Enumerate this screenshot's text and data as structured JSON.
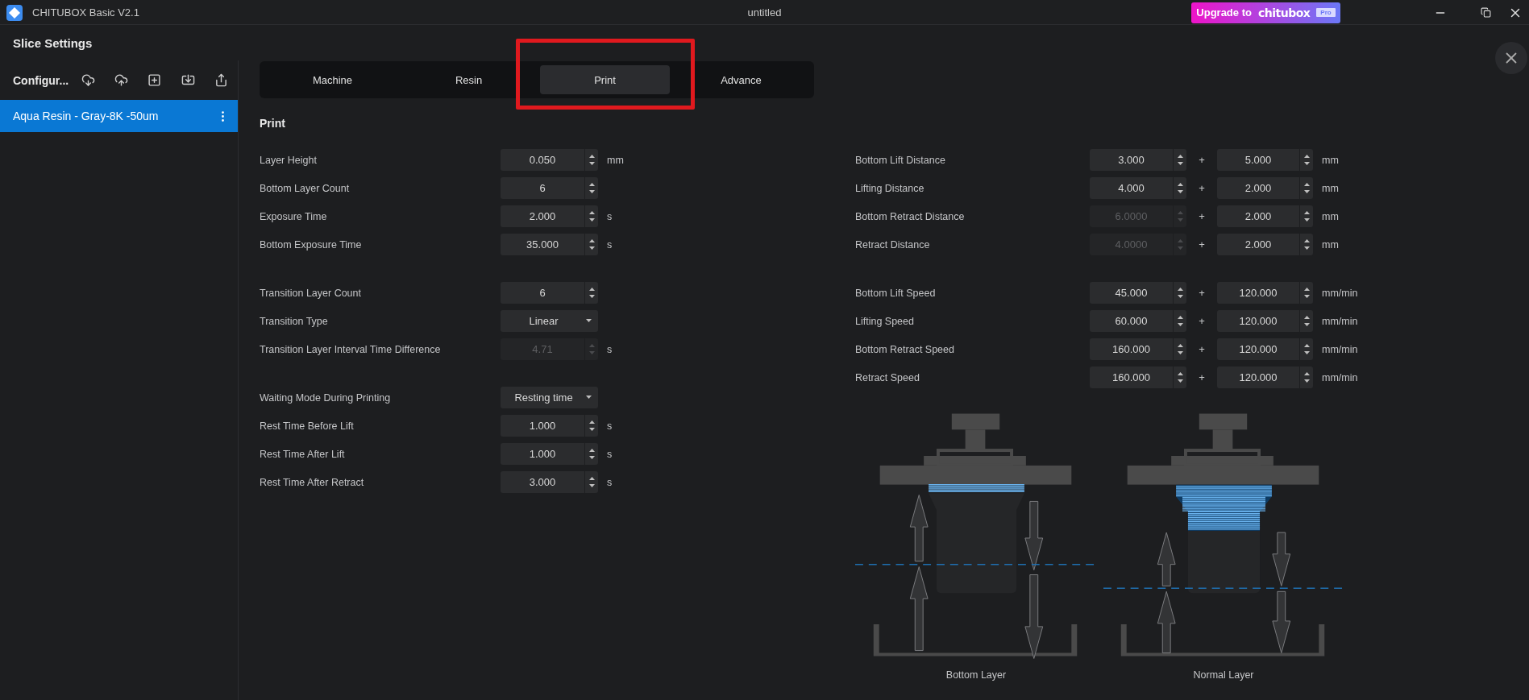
{
  "window": {
    "title": "CHITUBOX Basic V2.1",
    "document": "untitled",
    "upgrade": {
      "label": "Upgrade to",
      "brand": "chitubox",
      "badge": "Pro"
    }
  },
  "panel_title": "Slice Settings",
  "sidebar": {
    "heading": "Configur...",
    "items": [
      {
        "label": "Aqua Resin - Gray-8K -50um",
        "selected": true
      }
    ]
  },
  "tabs": [
    {
      "label": "Machine",
      "selected": false
    },
    {
      "label": "Resin",
      "selected": false
    },
    {
      "label": "Print",
      "selected": true
    },
    {
      "label": "Advance",
      "selected": false
    }
  ],
  "section_title": "Print",
  "left_groups": [
    [
      {
        "label": "Layer Height",
        "kind": "spin",
        "value": "0.050",
        "unit": "mm",
        "disabled": false
      },
      {
        "label": "Bottom Layer Count",
        "kind": "spin",
        "value": "6",
        "disabled": false
      },
      {
        "label": "Exposure Time",
        "kind": "spin",
        "value": "2.000",
        "unit": "s",
        "disabled": false
      },
      {
        "label": "Bottom Exposure Time",
        "kind": "spin",
        "value": "35.000",
        "unit": "s",
        "disabled": false
      }
    ],
    [
      {
        "label": "Transition Layer Count",
        "kind": "spin",
        "value": "6",
        "disabled": false
      },
      {
        "label": "Transition Type",
        "kind": "select",
        "value": "Linear",
        "disabled": false
      },
      {
        "label": "Transition Layer Interval Time Difference",
        "kind": "spin",
        "value": "4.71",
        "unit": "s",
        "disabled": true
      }
    ],
    [
      {
        "label": "Waiting Mode During Printing",
        "kind": "select",
        "value": "Resting time",
        "disabled": false
      },
      {
        "label": "Rest Time Before Lift",
        "kind": "spin",
        "value": "1.000",
        "unit": "s",
        "disabled": false
      },
      {
        "label": "Rest Time After Lift",
        "kind": "spin",
        "value": "1.000",
        "unit": "s",
        "disabled": false
      },
      {
        "label": "Rest Time After Retract",
        "kind": "spin",
        "value": "3.000",
        "unit": "s",
        "disabled": false
      }
    ]
  ],
  "right_groups": [
    [
      {
        "label": "Bottom Lift Distance",
        "first": {
          "value": "3.000",
          "disabled": false
        },
        "plus": "+",
        "second": "5.000",
        "unit": "mm"
      },
      {
        "label": "Lifting Distance",
        "first": {
          "value": "4.000",
          "disabled": false
        },
        "plus": "+",
        "second": "2.000",
        "unit": "mm"
      },
      {
        "label": "Bottom Retract Distance",
        "first": {
          "value": "6.0000",
          "disabled": true
        },
        "plus": "+",
        "second": "2.000",
        "unit": "mm"
      },
      {
        "label": "Retract Distance",
        "first": {
          "value": "4.0000",
          "disabled": true
        },
        "plus": "+",
        "second": "2.000",
        "unit": "mm"
      }
    ],
    [
      {
        "label": "Bottom Lift Speed",
        "first": {
          "value": "45.000",
          "disabled": false
        },
        "plus": "+",
        "second": "120.000",
        "unit": "mm/min"
      },
      {
        "label": "Lifting Speed",
        "first": {
          "value": "60.000",
          "disabled": false
        },
        "plus": "+",
        "second": "120.000",
        "unit": "mm/min"
      },
      {
        "label": "Bottom Retract Speed",
        "first": {
          "value": "160.000",
          "disabled": false
        },
        "plus": "+",
        "second": "120.000",
        "unit": "mm/min"
      },
      {
        "label": "Retract Speed",
        "first": {
          "value": "160.000",
          "disabled": false
        },
        "plus": "+",
        "second": "120.000",
        "unit": "mm/min"
      }
    ]
  ],
  "diagram": [
    {
      "kind": "bottom",
      "caption": "Bottom Layer"
    },
    {
      "kind": "normal",
      "caption": "Normal Layer"
    }
  ]
}
